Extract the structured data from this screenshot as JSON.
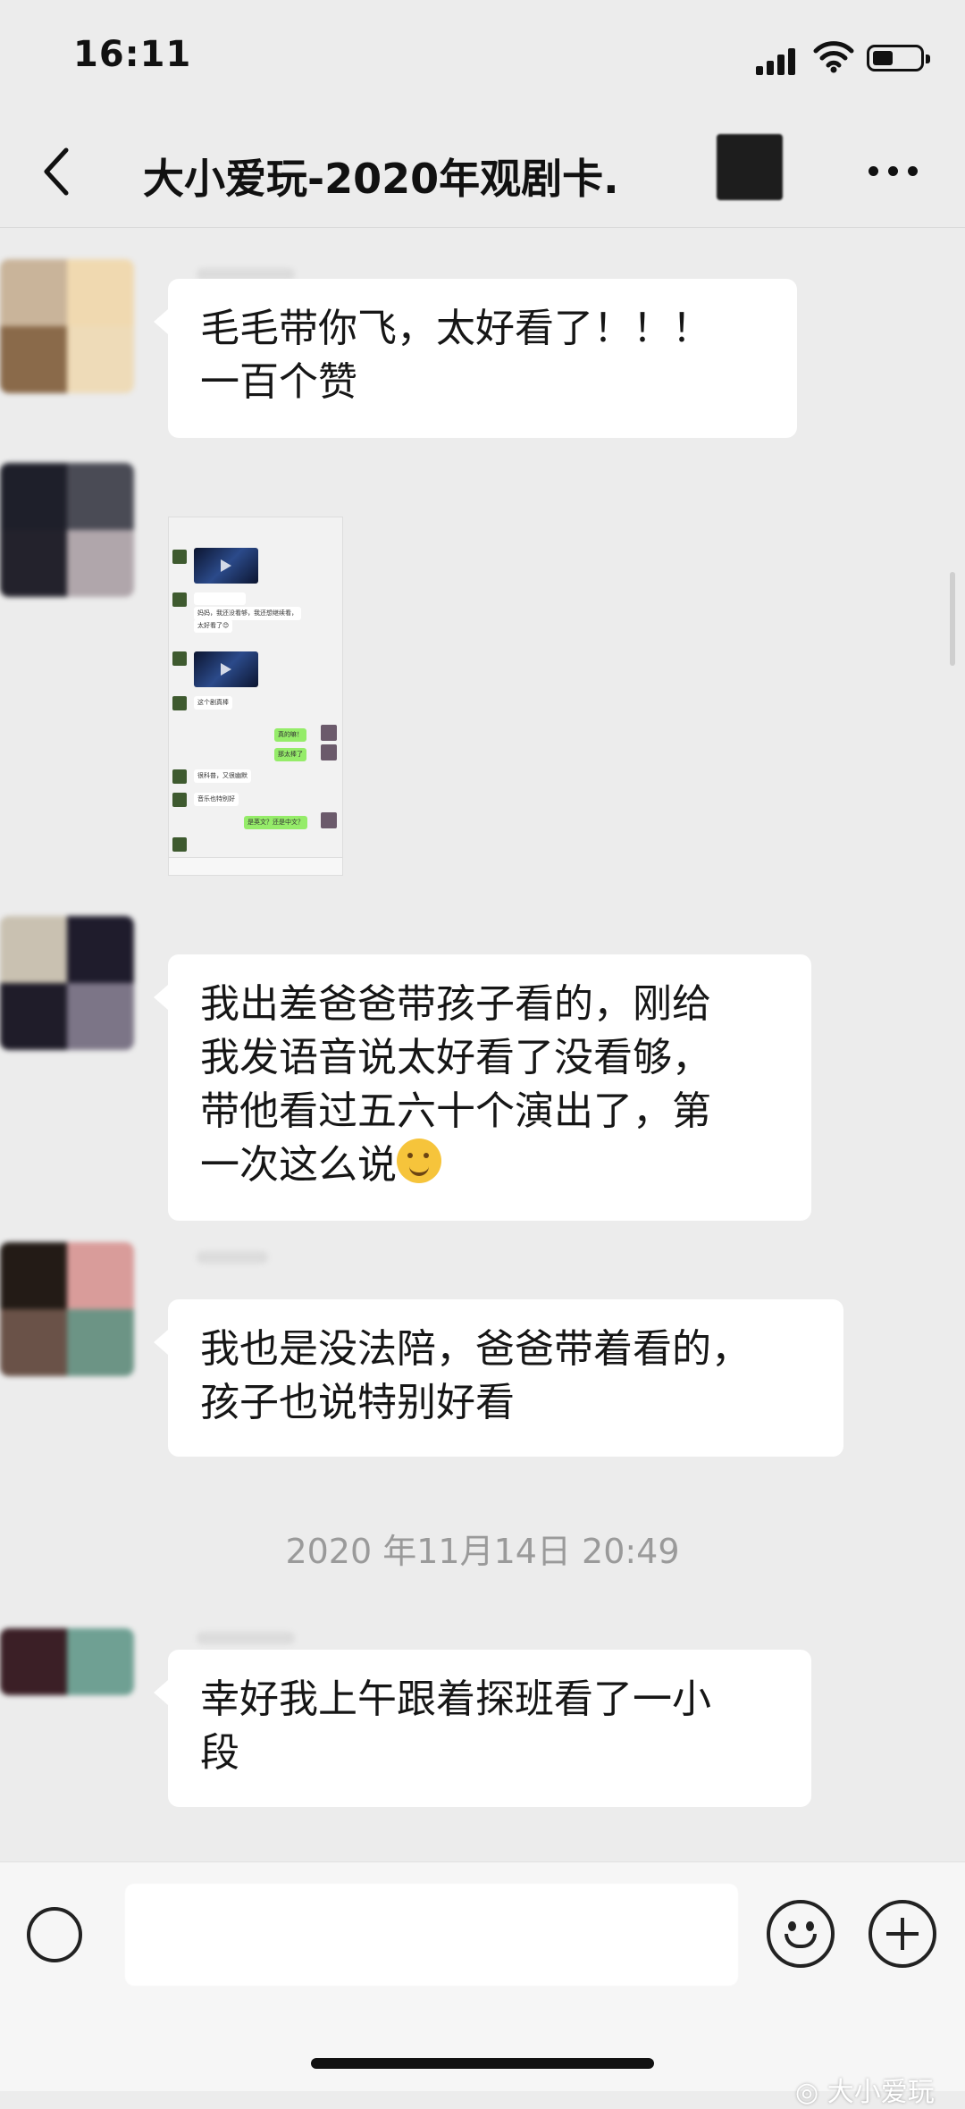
{
  "status_bar": {
    "time": "16:11"
  },
  "header": {
    "back_icon": "chevron-left-icon",
    "title": "大小爱玩-2020年观剧卡.",
    "more_icon": "more-dots-icon"
  },
  "messages": [
    {
      "type": "text",
      "lines": [
        "毛毛带你飞，太好看了！！！",
        "一百个赞"
      ]
    },
    {
      "type": "image"
    },
    {
      "type": "text",
      "lines": [
        "我出差爸爸带孩子看的，刚给",
        "我发语音说太好看了没看够，",
        "带他看过五六十个演出了，第",
        "一次这么说"
      ],
      "emoji": "thinking-face"
    },
    {
      "type": "text",
      "lines": [
        "我也是没法陪，爸爸带着看的，",
        "孩子也说特别好看"
      ]
    },
    {
      "type": "text",
      "lines": [
        "幸好我上午跟着探班看了一小",
        "段"
      ]
    }
  ],
  "time_separator": "2020 年11月14日 20:49",
  "mini_screenshot": {
    "texts": [
      "妈妈，我还没看够，我还想继续看，",
      "太好看了😊",
      "这个剧真棒",
      "真的嘛！",
      "那太棒了",
      "很科普，又很幽默",
      "音乐也特别好",
      "是英文？还是中文？"
    ]
  },
  "input_bar": {
    "voice_icon": "voice-icon",
    "emoji_icon": "emoji-icon",
    "plus_icon": "plus-icon"
  },
  "watermark": "大小爱玩",
  "colors": {
    "background": "#ececec",
    "bubble": "#ffffff",
    "accent_green": "#95ec69"
  }
}
